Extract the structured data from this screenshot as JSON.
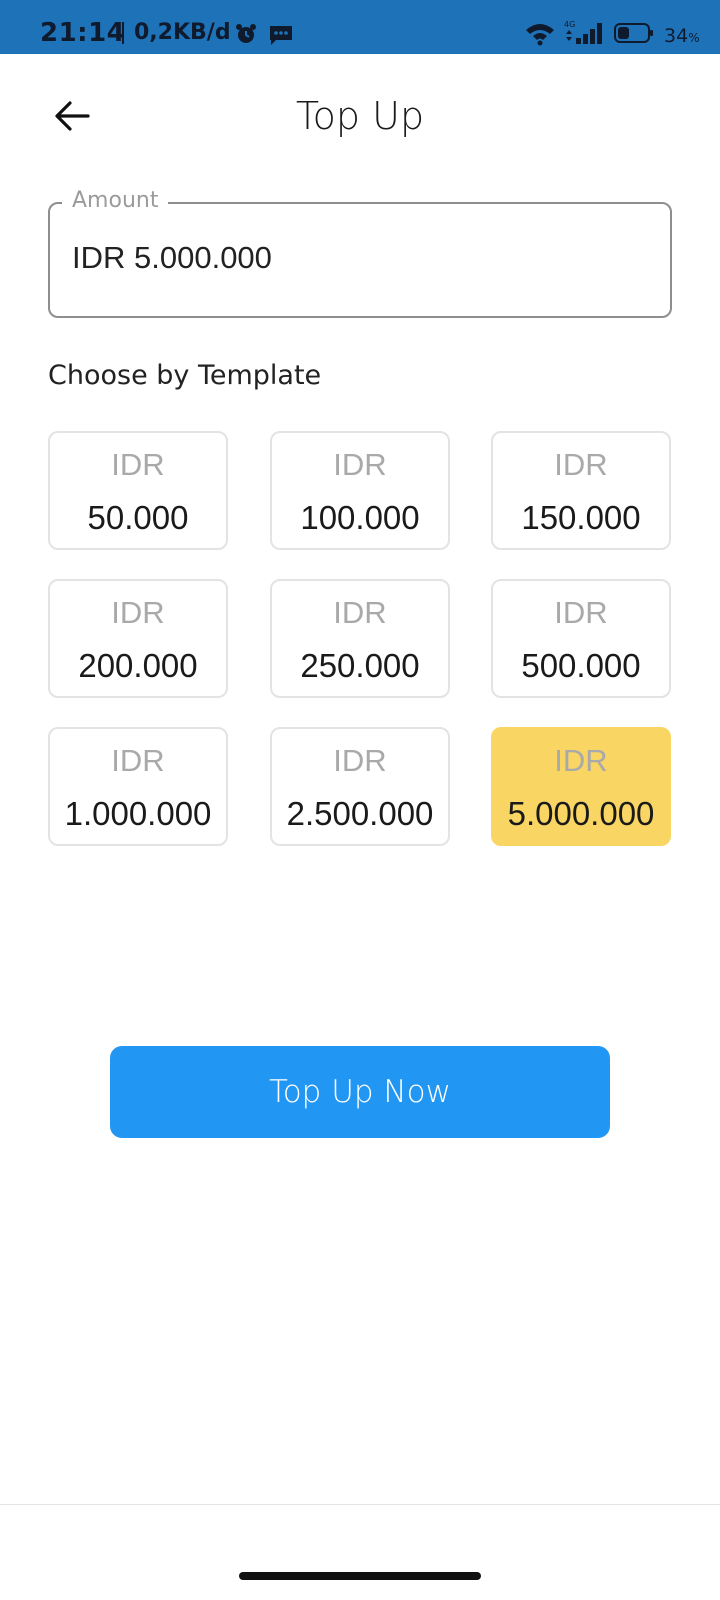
{
  "status_bar": {
    "time": "21:14",
    "net_speed": "0,2KB/d",
    "network_type": "4G",
    "battery_percent": "34",
    "battery_unit": "%",
    "icons": [
      "alarm-icon",
      "message-icon",
      "wifi-icon",
      "signal-icon",
      "battery-icon"
    ]
  },
  "header": {
    "title": "Top Up",
    "back_icon": "arrow-left-icon"
  },
  "amount": {
    "label": "Amount",
    "value": "IDR 5.000.000"
  },
  "templates": {
    "label": "Choose by Template",
    "items": [
      {
        "currency": "IDR",
        "amount": "50.000",
        "selected": false
      },
      {
        "currency": "IDR",
        "amount": "100.000",
        "selected": false
      },
      {
        "currency": "IDR",
        "amount": "150.000",
        "selected": false
      },
      {
        "currency": "IDR",
        "amount": "200.000",
        "selected": false
      },
      {
        "currency": "IDR",
        "amount": "250.000",
        "selected": false
      },
      {
        "currency": "IDR",
        "amount": "500.000",
        "selected": false
      },
      {
        "currency": "IDR",
        "amount": "1.000.000",
        "selected": false
      },
      {
        "currency": "IDR",
        "amount": "2.500.000",
        "selected": false
      },
      {
        "currency": "IDR",
        "amount": "5.000.000",
        "selected": true
      }
    ]
  },
  "actions": {
    "primary_label": "Top Up Now"
  },
  "colors": {
    "status_bar": "#1e72b8",
    "primary": "#2196f3",
    "selected_tile": "#f9d663",
    "tile_border": "#e3e3e3"
  }
}
